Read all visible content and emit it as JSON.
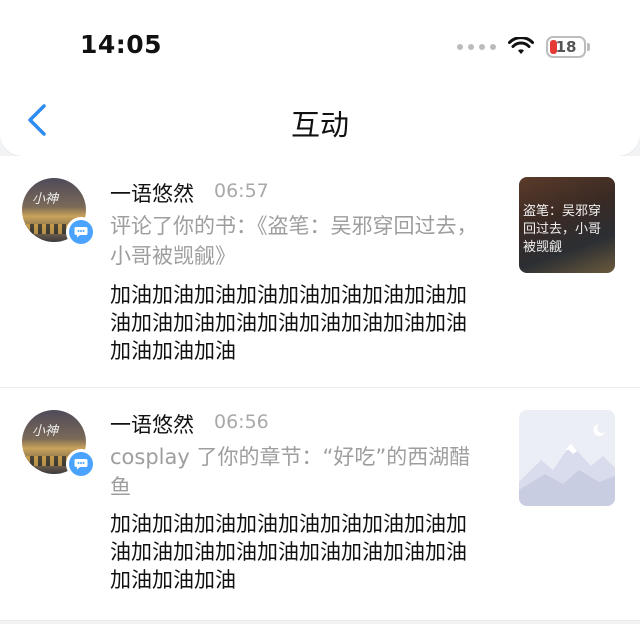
{
  "status_bar": {
    "time": "14:05",
    "battery_level": "18",
    "battery_color": "#e53935"
  },
  "nav": {
    "back_icon": "chevron-left-icon",
    "title": "互动",
    "accent_color": "#2d8cf0"
  },
  "items": [
    {
      "user_name": "一语悠然",
      "time": "06:57",
      "description": "评论了你的书：《盗笔：吴邪穿回过去，小哥被觊觎》",
      "comment": "加油加油加油加油加油加油加油加油加油加油加油加油加油加油加油加油加油加油加油加油",
      "thumbnail_text": "盗笔：吴邪穿回过去，小哥被觊觎",
      "avatar_signature": "小神",
      "badge_icon": "comment-icon"
    },
    {
      "user_name": "一语悠然",
      "time": "06:56",
      "description": "cosplay 了你的章节：“好吃”的西湖醋鱼",
      "comment": "加油加油加油加油加油加油加油加油加油加油加油加油加油加油加油加油加油加油加油加油",
      "thumbnail_icon": "mountain-placeholder-icon",
      "avatar_signature": "小神",
      "badge_icon": "comment-icon"
    }
  ]
}
